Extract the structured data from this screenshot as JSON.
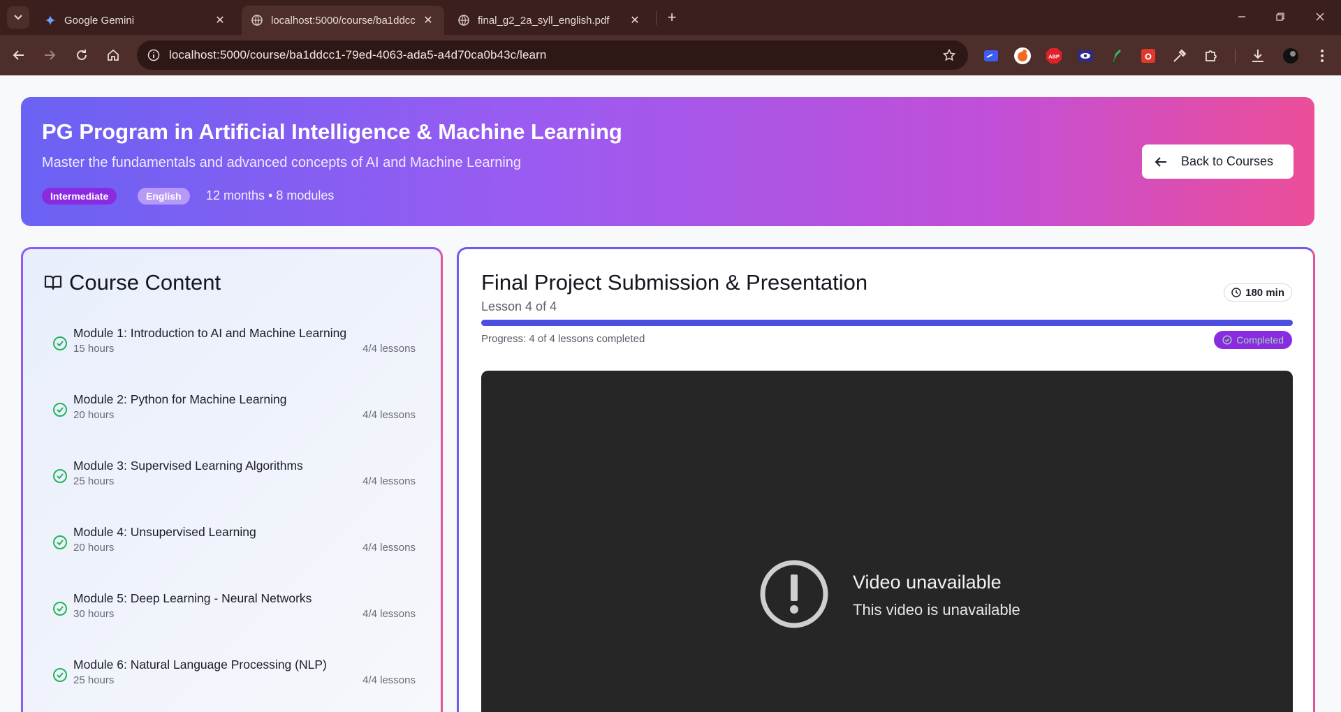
{
  "browser": {
    "tabs": [
      {
        "title": "Google Gemini",
        "active": false
      },
      {
        "title": "localhost:5000/course/ba1ddcc",
        "active": true
      },
      {
        "title": "final_g2_2a_syll_english.pdf",
        "active": false
      }
    ],
    "url": "localhost:5000/course/ba1ddcc1-79ed-4063-ada5-a4d70ca0b43c/learn",
    "extensions": [
      "bitwarden-icon",
      "wappalyzer-icon",
      "adblock-plus-icon",
      "eye-icon",
      "pen-icon",
      "screenshot-icon",
      "color-picker-icon",
      "extensions-puzzle-icon",
      "download-icon",
      "profile-avatar"
    ]
  },
  "course": {
    "title": "PG Program in Artificial Intelligence & Machine Learning",
    "subtitle": "Master the fundamentals and advanced concepts of AI and Machine Learning",
    "level": "Intermediate",
    "language": "English",
    "meta": "12 months • 8 modules",
    "back_label": "Back to Courses"
  },
  "sidebar": {
    "title": "Course Content",
    "modules": [
      {
        "title": "Module 1: Introduction to AI and Machine Learning",
        "hours": "15 hours",
        "lessons": "4/4 lessons"
      },
      {
        "title": "Module 2: Python for Machine Learning",
        "hours": "20 hours",
        "lessons": "4/4 lessons"
      },
      {
        "title": "Module 3: Supervised Learning Algorithms",
        "hours": "25 hours",
        "lessons": "4/4 lessons"
      },
      {
        "title": "Module 4: Unsupervised Learning",
        "hours": "20 hours",
        "lessons": "4/4 lessons"
      },
      {
        "title": "Module 5: Deep Learning - Neural Networks",
        "hours": "30 hours",
        "lessons": "4/4 lessons"
      },
      {
        "title": "Module 6: Natural Language Processing (NLP)",
        "hours": "25 hours",
        "lessons": "4/4 lessons"
      }
    ]
  },
  "lesson": {
    "title": "Final Project Submission & Presentation",
    "position": "Lesson 4 of 4",
    "duration": "180 min",
    "progress_fraction": 1.0,
    "progress_text": "Progress: 4 of 4 lessons completed",
    "status": "Completed"
  },
  "video": {
    "title": "Video unavailable",
    "message": "This video is unavailable"
  },
  "colors": {
    "accent": "#4b4ee0",
    "badge_purple": "#8a2be2",
    "success_green": "#22b45a"
  }
}
